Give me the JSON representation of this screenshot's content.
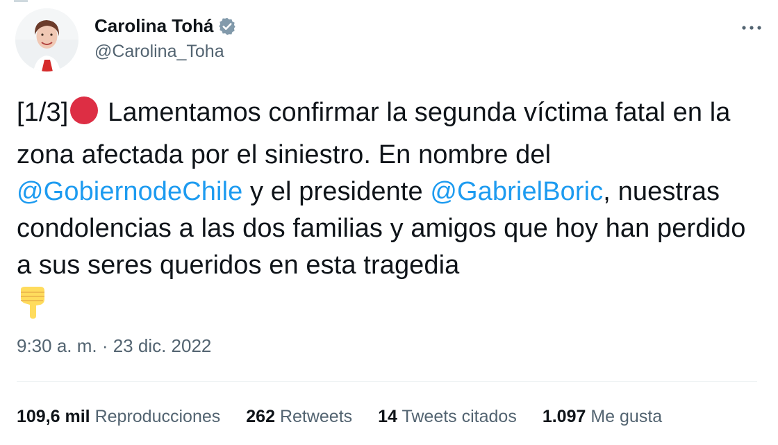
{
  "author": {
    "name": "Carolina Tohá",
    "handle": "@Carolina_Toha",
    "verified": true
  },
  "tweet": {
    "segments": [
      {
        "type": "text",
        "value": "[1/3]"
      },
      {
        "type": "emoji",
        "icon": "red-circle-emoji"
      },
      {
        "type": "text",
        "value": " Lamentamos confirmar la segunda víctima fatal en la zona afectada por el siniestro. En nombre del "
      },
      {
        "type": "mention",
        "value": "@GobiernodeChile"
      },
      {
        "type": "text",
        "value": " y el presidente "
      },
      {
        "type": "mention",
        "value": "@GabrielBoric"
      },
      {
        "type": "text",
        "value": ", nuestras condolencias a las dos familias y amigos que hoy han perdido a sus seres queridos en esta tragedia"
      },
      {
        "type": "emoji",
        "icon": "backhand-index-pointing-down-emoji"
      }
    ],
    "timestamp": "9:30 a. m. · 23 dic. 2022"
  },
  "stats": [
    {
      "number": "109,6 mil",
      "label": "Reproducciones"
    },
    {
      "number": "262",
      "label": "Retweets"
    },
    {
      "number": "14",
      "label": "Tweets citados"
    },
    {
      "number": "1.097",
      "label": "Me gusta"
    }
  ],
  "colors": {
    "text": "#0f1419",
    "secondary": "#536471",
    "mention": "#1d9bf0",
    "verified_badge": "#829aab",
    "red_circle": "#dd2e44",
    "emoji_hand": "#ffdc5d"
  }
}
